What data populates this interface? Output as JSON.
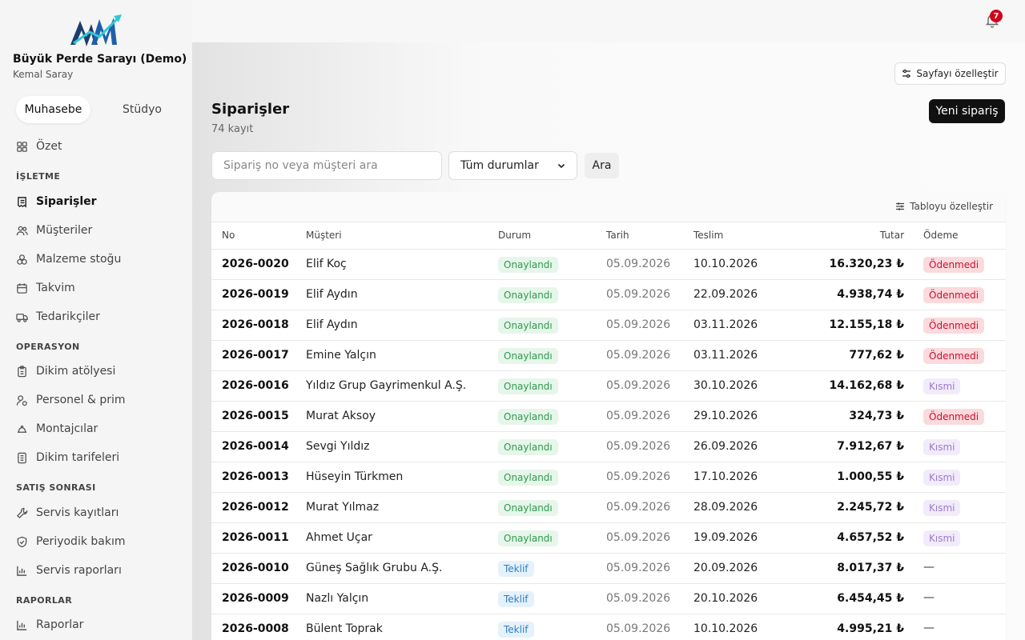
{
  "sidebar": {
    "org_name": "Büyük Perde Sarayı (Demo)",
    "user_name": "Kemal Saray",
    "modes": [
      "Muhasebe",
      "Stüdyo"
    ],
    "overview": "Özet",
    "sections": {
      "isletme": "İŞLETME",
      "operasyon": "OPERASYON",
      "satis_sonrasi": "SATIŞ SONRASI",
      "raporlar": "RAPORLAR"
    },
    "items": {
      "siparisler": "Siparişler",
      "musteriler": "Müşteriler",
      "malzeme": "Malzeme stoğu",
      "takvim": "Takvim",
      "tedarikciler": "Tedarikçiler",
      "dikim": "Dikim atölyesi",
      "personel": "Personel & prim",
      "montajcilar": "Montajcılar",
      "tarifeler": "Dikim tarifeleri",
      "servis": "Servis kayıtları",
      "bakim": "Periyodik bakım",
      "servis_rapor": "Servis raporları",
      "raporlar": "Raporlar"
    }
  },
  "topbar": {
    "notification_count": "7"
  },
  "page": {
    "customize_label": "Sayfayı özelleştir",
    "title": "Siparişler",
    "count": "74 kayıt",
    "new_button": "Yeni sipariş",
    "search_placeholder": "Sipariş no veya müşteri ara",
    "status_filter": "Tüm durumlar",
    "search_button": "Ara"
  },
  "table": {
    "customize_label": "Tabloyu özelleştir",
    "headers": [
      "No",
      "Müşteri",
      "Durum",
      "Tarih",
      "Teslim",
      "Tutar",
      "Ödeme"
    ],
    "rows": [
      {
        "no": "2026-0020",
        "customer": "Elif Koç",
        "status": "Onaylandı",
        "status_type": "green",
        "date": "05.09.2026",
        "delivery": "10.10.2026",
        "amount": "16.320,23 ₺",
        "payment": "Ödenmedi",
        "payment_type": "red"
      },
      {
        "no": "2026-0019",
        "customer": "Elif Aydın",
        "status": "Onaylandı",
        "status_type": "green",
        "date": "05.09.2026",
        "delivery": "22.09.2026",
        "amount": "4.938,74 ₺",
        "payment": "Ödenmedi",
        "payment_type": "red"
      },
      {
        "no": "2026-0018",
        "customer": "Elif Aydın",
        "status": "Onaylandı",
        "status_type": "green",
        "date": "05.09.2026",
        "delivery": "03.11.2026",
        "amount": "12.155,18 ₺",
        "payment": "Ödenmedi",
        "payment_type": "red"
      },
      {
        "no": "2026-0017",
        "customer": "Emine Yalçın",
        "status": "Onaylandı",
        "status_type": "green",
        "date": "05.09.2026",
        "delivery": "03.11.2026",
        "amount": "777,62 ₺",
        "payment": "Ödenmedi",
        "payment_type": "red"
      },
      {
        "no": "2026-0016",
        "customer": "Yıldız Grup Gayrimenkul A.Ş.",
        "status": "Onaylandı",
        "status_type": "green",
        "date": "05.09.2026",
        "delivery": "30.10.2026",
        "amount": "14.162,68 ₺",
        "payment": "Kısmi",
        "payment_type": "purple"
      },
      {
        "no": "2026-0015",
        "customer": "Murat Aksoy",
        "status": "Onaylandı",
        "status_type": "green",
        "date": "05.09.2026",
        "delivery": "29.10.2026",
        "amount": "324,73 ₺",
        "payment": "Ödenmedi",
        "payment_type": "red"
      },
      {
        "no": "2026-0014",
        "customer": "Sevgi Yıldız",
        "status": "Onaylandı",
        "status_type": "green",
        "date": "05.09.2026",
        "delivery": "26.09.2026",
        "amount": "7.912,67 ₺",
        "payment": "Kısmi",
        "payment_type": "purple"
      },
      {
        "no": "2026-0013",
        "customer": "Hüseyin Türkmen",
        "status": "Onaylandı",
        "status_type": "green",
        "date": "05.09.2026",
        "delivery": "17.10.2026",
        "amount": "1.000,55 ₺",
        "payment": "Kısmi",
        "payment_type": "purple"
      },
      {
        "no": "2026-0012",
        "customer": "Murat Yılmaz",
        "status": "Onaylandı",
        "status_type": "green",
        "date": "05.09.2026",
        "delivery": "28.09.2026",
        "amount": "2.245,72 ₺",
        "payment": "Kısmi",
        "payment_type": "purple"
      },
      {
        "no": "2026-0011",
        "customer": "Ahmet Uçar",
        "status": "Onaylandı",
        "status_type": "green",
        "date": "05.09.2026",
        "delivery": "19.09.2026",
        "amount": "4.657,52 ₺",
        "payment": "Kısmi",
        "payment_type": "purple"
      },
      {
        "no": "2026-0010",
        "customer": "Güneş Sağlık Grubu A.Ş.",
        "status": "Teklif",
        "status_type": "blue",
        "date": "05.09.2026",
        "delivery": "20.09.2026",
        "amount": "8.017,37 ₺",
        "payment": "—",
        "payment_type": "none"
      },
      {
        "no": "2026-0009",
        "customer": "Nazlı Yalçın",
        "status": "Teklif",
        "status_type": "blue",
        "date": "05.09.2026",
        "delivery": "20.10.2026",
        "amount": "6.454,45 ₺",
        "payment": "—",
        "payment_type": "none"
      },
      {
        "no": "2026-0008",
        "customer": "Bülent Toprak",
        "status": "Teklif",
        "status_type": "blue",
        "date": "05.09.2026",
        "delivery": "10.10.2026",
        "amount": "4.995,21 ₺",
        "payment": "—",
        "payment_type": "none"
      }
    ]
  },
  "colors": {
    "accent": "#111111",
    "status_green": "#2f9a4c",
    "status_blue": "#2d7fc1",
    "payment_red": "#c8102e",
    "payment_purple": "#9b7ad0",
    "notification_badge": "#d0021b"
  },
  "icons": [
    "logo-icon",
    "bell-icon",
    "sliders-icon",
    "grid-icon",
    "receipt-icon",
    "users-icon",
    "boxes-icon",
    "calendar-icon",
    "truck-icon",
    "clipboard-icon",
    "user-plus-icon",
    "hardhat-icon",
    "list-icon",
    "wrench-icon",
    "shield-icon",
    "bar-chart-icon",
    "chevron-down-icon"
  ]
}
